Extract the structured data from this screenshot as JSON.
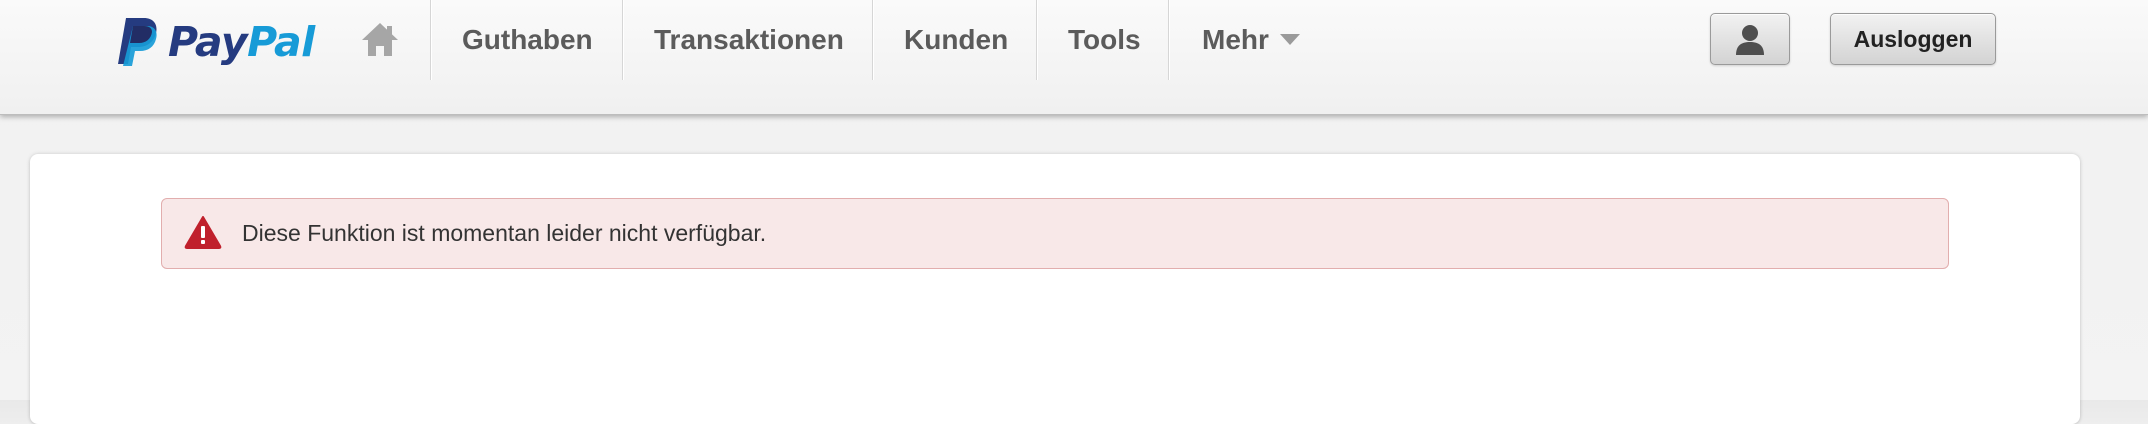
{
  "brand": {
    "pay": "Pay",
    "pal": "Pal",
    "colors": {
      "dark_blue": "#253b80",
      "light_blue": "#179bd7"
    }
  },
  "nav": {
    "home_icon": "home-icon",
    "items": [
      {
        "label": "Guthaben"
      },
      {
        "label": "Transaktionen"
      },
      {
        "label": "Kunden"
      },
      {
        "label": "Tools"
      },
      {
        "label": "Mehr",
        "icon": "chevron-down-icon"
      }
    ],
    "profile_icon": "user-silhouette-icon",
    "logout_label": "Ausloggen"
  },
  "alert": {
    "icon": "warning-triangle-icon",
    "message": "Diese Funktion ist momentan leider nicht verfügbar.",
    "colors": {
      "background": "#f8e8e8",
      "border": "#e2aeae",
      "icon": "#c0202c"
    }
  }
}
